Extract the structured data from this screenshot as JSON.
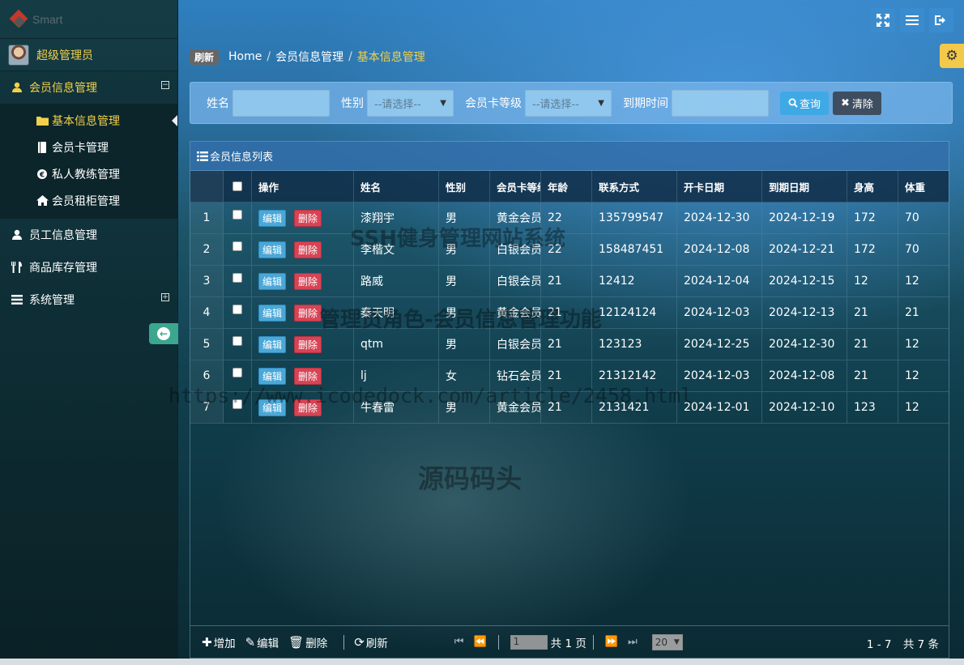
{
  "brand": {
    "name": "Smart"
  },
  "user": {
    "name": "超级管理员"
  },
  "sidebar": {
    "groups": [
      {
        "label": "会员信息管理",
        "icon": "user-icon",
        "toggle": "⊟"
      },
      {
        "label": "员工信息管理",
        "icon": "user-icon"
      },
      {
        "label": "商品库存管理",
        "icon": "cutlery-icon"
      },
      {
        "label": "系统管理",
        "icon": "list-icon",
        "toggle": "⊞"
      }
    ],
    "sub_items": [
      {
        "label": "基本信息管理",
        "icon": "folder-icon"
      },
      {
        "label": "会员卡管理",
        "icon": "book-icon"
      },
      {
        "label": "私人教练管理",
        "icon": "copyright-icon"
      },
      {
        "label": "会员租柜管理",
        "icon": "home-icon"
      }
    ]
  },
  "breadcrumb": {
    "refresh": "刷新",
    "items": [
      "Home",
      "会员信息管理",
      "基本信息管理"
    ],
    "sep": "/"
  },
  "search": {
    "name_label": "姓名",
    "gender_label": "性别",
    "gender_value": "--请选择--",
    "level_label": "会员卡等级",
    "level_value": "--请选择--",
    "expire_label": "到期时间",
    "query_label": "查询",
    "clear_label": "清除"
  },
  "grid": {
    "title": "会员信息列表",
    "columns": [
      "操作",
      "姓名",
      "性别",
      "会员卡等级",
      "年龄",
      "联系方式",
      "开卡日期",
      "到期日期",
      "身高",
      "体重"
    ],
    "edit_label": "编辑",
    "delete_label": "删除",
    "rows": [
      [
        "1",
        "漆翔宇",
        "男",
        "黄金会员",
        "22",
        "135799547",
        "2024-12-30",
        "2024-12-19",
        "172",
        "70"
      ],
      [
        "2",
        "李楷文",
        "男",
        "白银会员",
        "22",
        "158487451",
        "2024-12-08",
        "2024-12-21",
        "172",
        "70"
      ],
      [
        "3",
        "路威",
        "男",
        "白银会员",
        "21",
        "12412",
        "2024-12-04",
        "2024-12-15",
        "12",
        "12"
      ],
      [
        "4",
        "秦天明",
        "男",
        "黄金会员",
        "21",
        "12124124",
        "2024-12-03",
        "2024-12-13",
        "21",
        "21"
      ],
      [
        "5",
        "qtm",
        "男",
        "白银会员",
        "21",
        "123123",
        "2024-12-25",
        "2024-12-30",
        "21",
        "12"
      ],
      [
        "6",
        "lj",
        "女",
        "钻石会员",
        "21",
        "21312142",
        "2024-12-03",
        "2024-12-08",
        "21",
        "12"
      ],
      [
        "7",
        "牛春雷",
        "男",
        "黄金会员",
        "21",
        "2131421",
        "2024-12-01",
        "2024-12-10",
        "123",
        "12"
      ]
    ]
  },
  "pager": {
    "add": "增加",
    "edit": "编辑",
    "delete": "删除",
    "refresh": "刷新",
    "page_value": "1",
    "total_pages": "共 1 页",
    "page_size": "20",
    "range": "1 - 7",
    "total": "共 7 条"
  },
  "watermarks": [
    "SSH健身管理网站系统",
    "管理员角色-会员信息管理功能",
    "https://www.icodedock.com/article/2458.html",
    "源码码头"
  ]
}
